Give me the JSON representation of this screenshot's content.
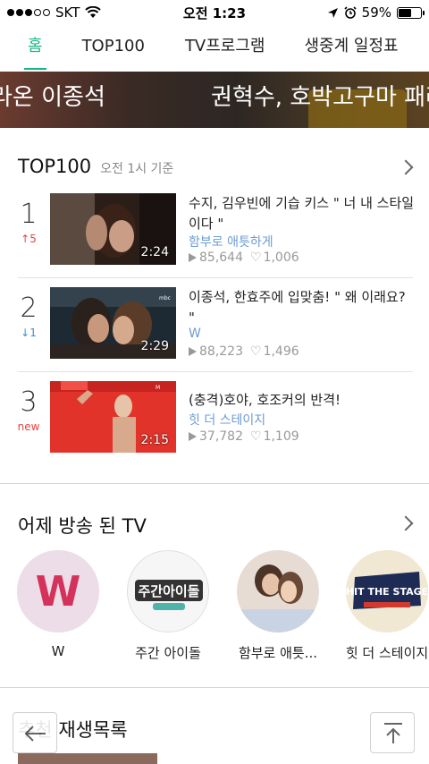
{
  "status_bar": {
    "carrier": "SKT",
    "time": "오전 1:23",
    "battery": "59%",
    "battery_level": 0.59
  },
  "tabs": [
    {
      "label": "홈",
      "active": true
    },
    {
      "label": "TOP100",
      "active": false
    },
    {
      "label": "TV프로그램",
      "active": false
    },
    {
      "label": "생중계 일정표",
      "active": false
    }
  ],
  "banner": {
    "text_left": "라온 이종석",
    "text_right": "권혁수, 호박고구마 패러"
  },
  "top100": {
    "title": "TOP100",
    "subtitle": "오전 1시 기준",
    "items": [
      {
        "rank": "1",
        "change": "↑5",
        "change_dir": "up",
        "duration": "2:24",
        "title": "수지, 김우빈에 기습 키스 \" 너 내 스타일이다 \"",
        "program": "함부로 애틋하게",
        "plays": "85,644",
        "likes": "1,006"
      },
      {
        "rank": "2",
        "change": "↓1",
        "change_dir": "down",
        "duration": "2:29",
        "title": "이종석, 한효주에 입맞춤! \" 왜 이래요? \"",
        "program": "W",
        "plays": "88,223",
        "likes": "1,496"
      },
      {
        "rank": "3",
        "change": "new",
        "change_dir": "new",
        "duration": "2:15",
        "title": "(충격)호야, 호조커의 반격!",
        "program": "힛 더 스테이지",
        "plays": "37,782",
        "likes": "1,109"
      }
    ]
  },
  "yesterday_tv": {
    "title": "어제 방송 된 TV",
    "items": [
      {
        "label": "W",
        "art": "W"
      },
      {
        "label": "주간 아이돌",
        "art": "주간아이돌"
      },
      {
        "label": "함부로 애틋...",
        "art": ""
      },
      {
        "label": "힛 더 스테이지",
        "art": "HIT THE STAGE"
      }
    ]
  },
  "recommended": {
    "title": "추천 재생목록"
  },
  "colors": {
    "accent": "#12b886",
    "up": "#e64545",
    "down": "#3a8fe0",
    "program": "#6b9cd4"
  }
}
